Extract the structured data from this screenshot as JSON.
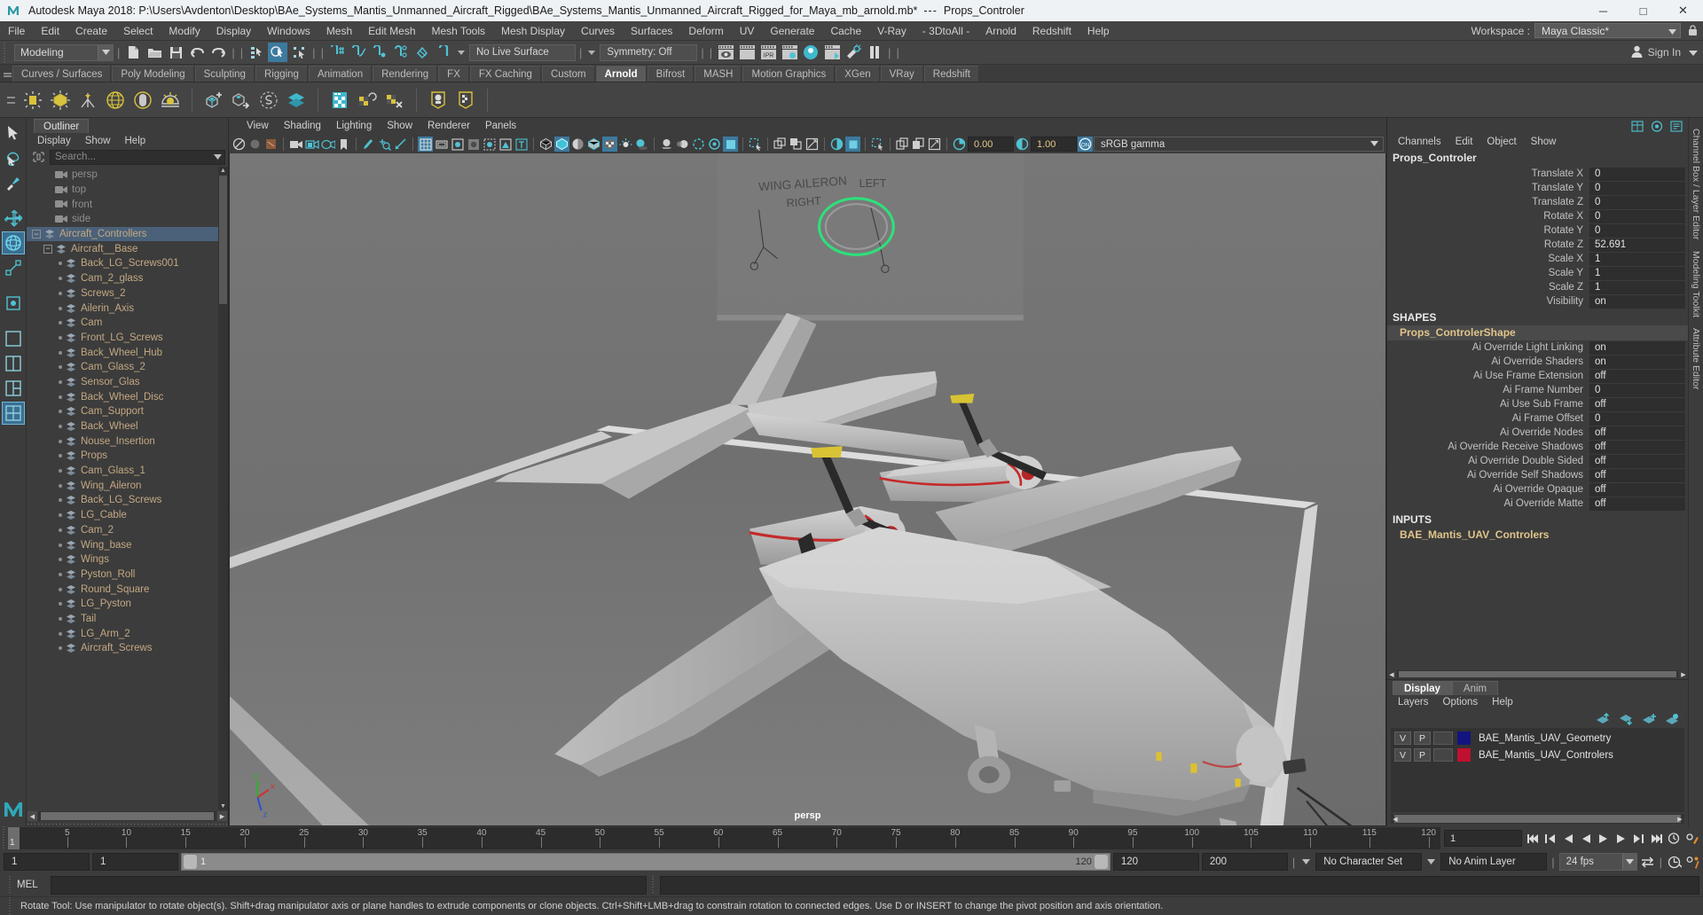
{
  "titlebar": {
    "app_title": "Autodesk Maya 2018: P:\\Users\\Avdenton\\Desktop\\BAe_Systems_Mantis_Unmanned_Aircraft_Rigged\\BAe_Systems_Mantis_Unmanned_Aircraft_Rigged_for_Maya_mb_arnold.mb*",
    "separator": "---",
    "selected_object": "Props_Controler",
    "minimize": "─",
    "maximize": "□",
    "close": "✕"
  },
  "menubar": {
    "items": [
      "File",
      "Edit",
      "Create",
      "Select",
      "Modify",
      "Display",
      "Windows",
      "Mesh",
      "Edit Mesh",
      "Mesh Tools",
      "Mesh Display",
      "Curves",
      "Surfaces",
      "Deform",
      "UV",
      "Generate",
      "Cache",
      "V-Ray",
      "- 3DtoAll -",
      "Arnold",
      "Redshift",
      "Help"
    ],
    "workspace_label": "Workspace :",
    "workspace_value": "Maya Classic*"
  },
  "statusbar": {
    "mode": "Modeling",
    "live_surface": "No Live Surface",
    "symmetry": "Symmetry: Off",
    "signin": "Sign In"
  },
  "shelf": {
    "tabs": [
      "Curves / Surfaces",
      "Poly Modeling",
      "Sculpting",
      "Rigging",
      "Animation",
      "Rendering",
      "FX",
      "FX Caching",
      "Custom",
      "Arnold",
      "Bifrost",
      "MASH",
      "Motion Graphics",
      "XGen",
      "VRay",
      "Redshift"
    ],
    "active_tab": "Arnold"
  },
  "outliner": {
    "tab": "Outliner",
    "menu": [
      "Display",
      "Show",
      "Help"
    ],
    "search_placeholder": "Search...",
    "items": [
      {
        "label": "persp",
        "type": "camera",
        "depth": 1
      },
      {
        "label": "top",
        "type": "camera",
        "depth": 1
      },
      {
        "label": "front",
        "type": "camera",
        "depth": 1
      },
      {
        "label": "side",
        "type": "camera",
        "depth": 1
      },
      {
        "label": "Aircraft_Controllers",
        "type": "group",
        "depth": 0,
        "expanded": true,
        "selected": true
      },
      {
        "label": "Aircraft__Base",
        "type": "group",
        "depth": 1,
        "expanded": true
      },
      {
        "label": "Back_LG_Screws001",
        "type": "mesh",
        "depth": 2
      },
      {
        "label": "Cam_2_glass",
        "type": "mesh",
        "depth": 2
      },
      {
        "label": "Screws_2",
        "type": "mesh",
        "depth": 2
      },
      {
        "label": "Ailerin_Axis",
        "type": "mesh",
        "depth": 2
      },
      {
        "label": "Cam",
        "type": "mesh",
        "depth": 2
      },
      {
        "label": "Front_LG_Screws",
        "type": "mesh",
        "depth": 2
      },
      {
        "label": "Back_Wheel_Hub",
        "type": "mesh",
        "depth": 2
      },
      {
        "label": "Cam_Glass_2",
        "type": "mesh",
        "depth": 2
      },
      {
        "label": "Sensor_Glas",
        "type": "mesh",
        "depth": 2
      },
      {
        "label": "Back_Wheel_Disc",
        "type": "mesh",
        "depth": 2
      },
      {
        "label": "Cam_Support",
        "type": "mesh",
        "depth": 2
      },
      {
        "label": "Back_Wheel",
        "type": "mesh",
        "depth": 2
      },
      {
        "label": "Nouse_Insertion",
        "type": "mesh",
        "depth": 2
      },
      {
        "label": "Props",
        "type": "mesh",
        "depth": 2
      },
      {
        "label": "Cam_Glass_1",
        "type": "mesh",
        "depth": 2
      },
      {
        "label": "Wing_Aileron",
        "type": "mesh",
        "depth": 2
      },
      {
        "label": "Back_LG_Screws",
        "type": "mesh",
        "depth": 2
      },
      {
        "label": "LG_Cable",
        "type": "mesh",
        "depth": 2
      },
      {
        "label": "Cam_2",
        "type": "mesh",
        "depth": 2
      },
      {
        "label": "Wing_base",
        "type": "mesh",
        "depth": 2
      },
      {
        "label": "Wings",
        "type": "mesh",
        "depth": 2
      },
      {
        "label": "Pyston_Roll",
        "type": "mesh",
        "depth": 2
      },
      {
        "label": "Round_Square",
        "type": "mesh",
        "depth": 2
      },
      {
        "label": "LG_Pyston",
        "type": "mesh",
        "depth": 2
      },
      {
        "label": "Tail",
        "type": "mesh",
        "depth": 2
      },
      {
        "label": "LG_Arm_2",
        "type": "mesh",
        "depth": 2
      },
      {
        "label": "Aircraft_Screws",
        "type": "mesh",
        "depth": 2
      }
    ]
  },
  "viewport": {
    "menu": [
      "View",
      "Shading",
      "Lighting",
      "Show",
      "Renderer",
      "Panels"
    ],
    "exposure": "0.00",
    "gamma_value": "1.00",
    "color_space": "sRGB gamma",
    "camera_label": "persp"
  },
  "channelbox": {
    "menu": [
      "Channels",
      "Edit",
      "Object",
      "Show"
    ],
    "node_name": "Props_Controler",
    "transforms": [
      {
        "label": "Translate X",
        "value": "0"
      },
      {
        "label": "Translate Y",
        "value": "0"
      },
      {
        "label": "Translate Z",
        "value": "0"
      },
      {
        "label": "Rotate X",
        "value": "0"
      },
      {
        "label": "Rotate Y",
        "value": "0"
      },
      {
        "label": "Rotate Z",
        "value": "52.691"
      },
      {
        "label": "Scale X",
        "value": "1"
      },
      {
        "label": "Scale Y",
        "value": "1"
      },
      {
        "label": "Scale Z",
        "value": "1"
      },
      {
        "label": "Visibility",
        "value": "on"
      }
    ],
    "shapes_header": "SHAPES",
    "shape_name": "Props_ControlerShape",
    "shape_attrs": [
      {
        "label": "Ai Override Light Linking",
        "value": "on"
      },
      {
        "label": "Ai Override Shaders",
        "value": "on"
      },
      {
        "label": "Ai Use Frame Extension",
        "value": "off"
      },
      {
        "label": "Ai Frame Number",
        "value": "0"
      },
      {
        "label": "Ai Use Sub Frame",
        "value": "off"
      },
      {
        "label": "Ai Frame Offset",
        "value": "0"
      },
      {
        "label": "Ai Override Nodes",
        "value": "off"
      },
      {
        "label": "Ai Override Receive Shadows",
        "value": "off"
      },
      {
        "label": "Ai Override Double Sided",
        "value": "off"
      },
      {
        "label": "Ai Override Self Shadows",
        "value": "off"
      },
      {
        "label": "Ai Override Opaque",
        "value": "off"
      },
      {
        "label": "Ai Override Matte",
        "value": "off"
      }
    ],
    "inputs_header": "INPUTS",
    "input_node": "BAE_Mantis_UAV_Controlers"
  },
  "layereditor": {
    "tabs": [
      "Display",
      "Anim"
    ],
    "active_tab": "Display",
    "menu": [
      "Layers",
      "Options",
      "Help"
    ],
    "layers": [
      {
        "visible": "V",
        "playback": "P",
        "color": "#141480",
        "name": "BAE_Mantis_UAV_Geometry"
      },
      {
        "visible": "V",
        "playback": "P",
        "color": "#c01030",
        "name": "BAE_Mantis_UAV_Controlers"
      }
    ]
  },
  "dock_labels": [
    "Channel Box / Layer Editor",
    "Modeling Toolkit",
    "Attribute Editor"
  ],
  "timeslider": {
    "ticks": [
      "5",
      "10",
      "15",
      "20",
      "25",
      "30",
      "35",
      "40",
      "45",
      "50",
      "55",
      "60",
      "65",
      "70",
      "75",
      "80",
      "85",
      "90",
      "95",
      "100",
      "105",
      "110",
      "115",
      "120"
    ],
    "current_frame": "1",
    "current_frame_field": "1",
    "playback_start_field": "1",
    "range_start_label": "1",
    "range_end_label": "120",
    "range_start": "1",
    "range_end": "120",
    "playback_end": "120",
    "anim_end": "200",
    "character_set": "No Character Set",
    "anim_layer": "No Anim Layer",
    "fps": "24 fps"
  },
  "commandline": {
    "label": "MEL"
  },
  "helpline": {
    "text": "Rotate Tool: Use manipulator to rotate object(s). Shift+drag manipulator axis or plane handles to extrude components or clone objects. Ctrl+Shift+LMB+drag to constrain rotation to connected edges. Use D or INSERT to change the pivot position and axis orientation."
  },
  "colors": {
    "accent_teal": "#4fc3d4",
    "selection_blue": "#4a6179",
    "node_text": "#c4a882",
    "panel_bg": "#3c3c3c",
    "viewport_bg": "#6e6e6e"
  }
}
